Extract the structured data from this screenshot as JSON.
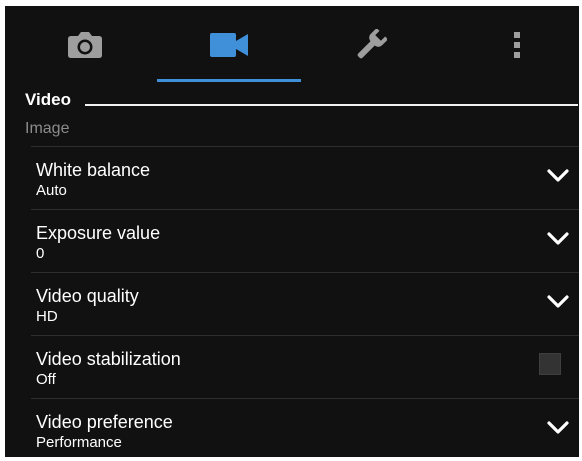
{
  "tabs": [
    {
      "icon": "camera-icon",
      "active": false
    },
    {
      "icon": "video-camera-icon",
      "active": true
    },
    {
      "icon": "wrench-icon",
      "active": false
    },
    {
      "icon": "more-vertical-icon",
      "active": false
    }
  ],
  "section": {
    "title": "Video",
    "subheader": "Image"
  },
  "settings": [
    {
      "label": "White balance",
      "value": "Auto",
      "control": "dropdown"
    },
    {
      "label": "Exposure value",
      "value": "0",
      "control": "dropdown"
    },
    {
      "label": "Video quality",
      "value": "HD",
      "control": "dropdown"
    },
    {
      "label": "Video stabilization",
      "value": "Off",
      "control": "checkbox",
      "checked": false
    },
    {
      "label": "Video preference",
      "value": "Performance",
      "control": "dropdown"
    }
  ],
  "colors": {
    "background": "#111112",
    "accent": "#3f8fd9",
    "text": "#ffffff",
    "subheader": "#8c8c8c"
  }
}
